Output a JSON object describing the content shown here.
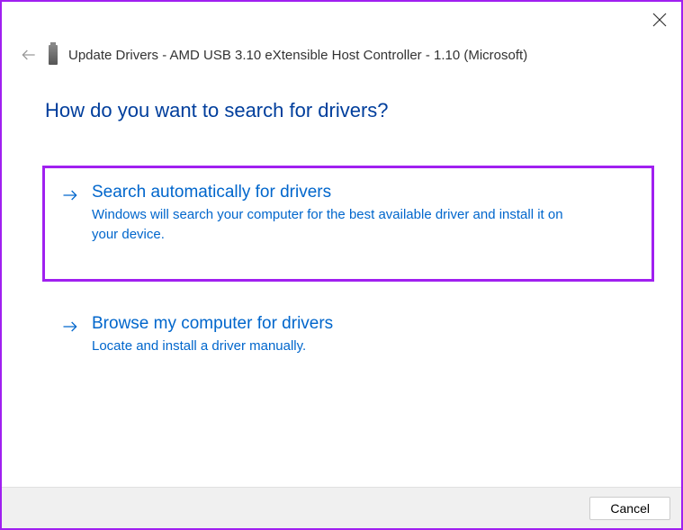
{
  "header": {
    "title": "Update Drivers - AMD USB 3.10 eXtensible Host Controller - 1.10 (Microsoft)"
  },
  "main": {
    "heading": "How do you want to search for drivers?",
    "options": [
      {
        "title": "Search automatically for drivers",
        "description": "Windows will search your computer for the best available driver and install it on your device."
      },
      {
        "title": "Browse my computer for drivers",
        "description": "Locate and install a driver manually."
      }
    ]
  },
  "footer": {
    "cancel_label": "Cancel"
  }
}
